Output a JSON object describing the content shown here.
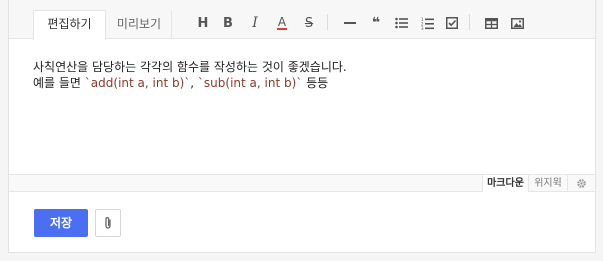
{
  "tabs": [
    {
      "label": "편집하기",
      "active": true
    },
    {
      "label": "미리보기",
      "active": false
    }
  ],
  "toolbar": {
    "heading": "H",
    "bold": "B",
    "italic": "I",
    "text_color": "A",
    "strike": "S",
    "quote": "❝"
  },
  "content": {
    "line1": "사칙연산을 담당하는 각각의 함수를 작성하는 것이 좋겠습니다.",
    "line2_prefix": "예를 들면 ",
    "code1": "`add(int a, int b)`",
    "comma": ", ",
    "code2": "`sub(int a, int b)`",
    "line2_suffix": " 등등"
  },
  "modes": {
    "markdown": "마크다운",
    "wysiwyg": "위지윅"
  },
  "footer": {
    "save_label": "저장"
  },
  "colors": {
    "primary": "#4b6ff2",
    "text_color_underline": "#e03c3c",
    "code": "#8a3b2a"
  }
}
